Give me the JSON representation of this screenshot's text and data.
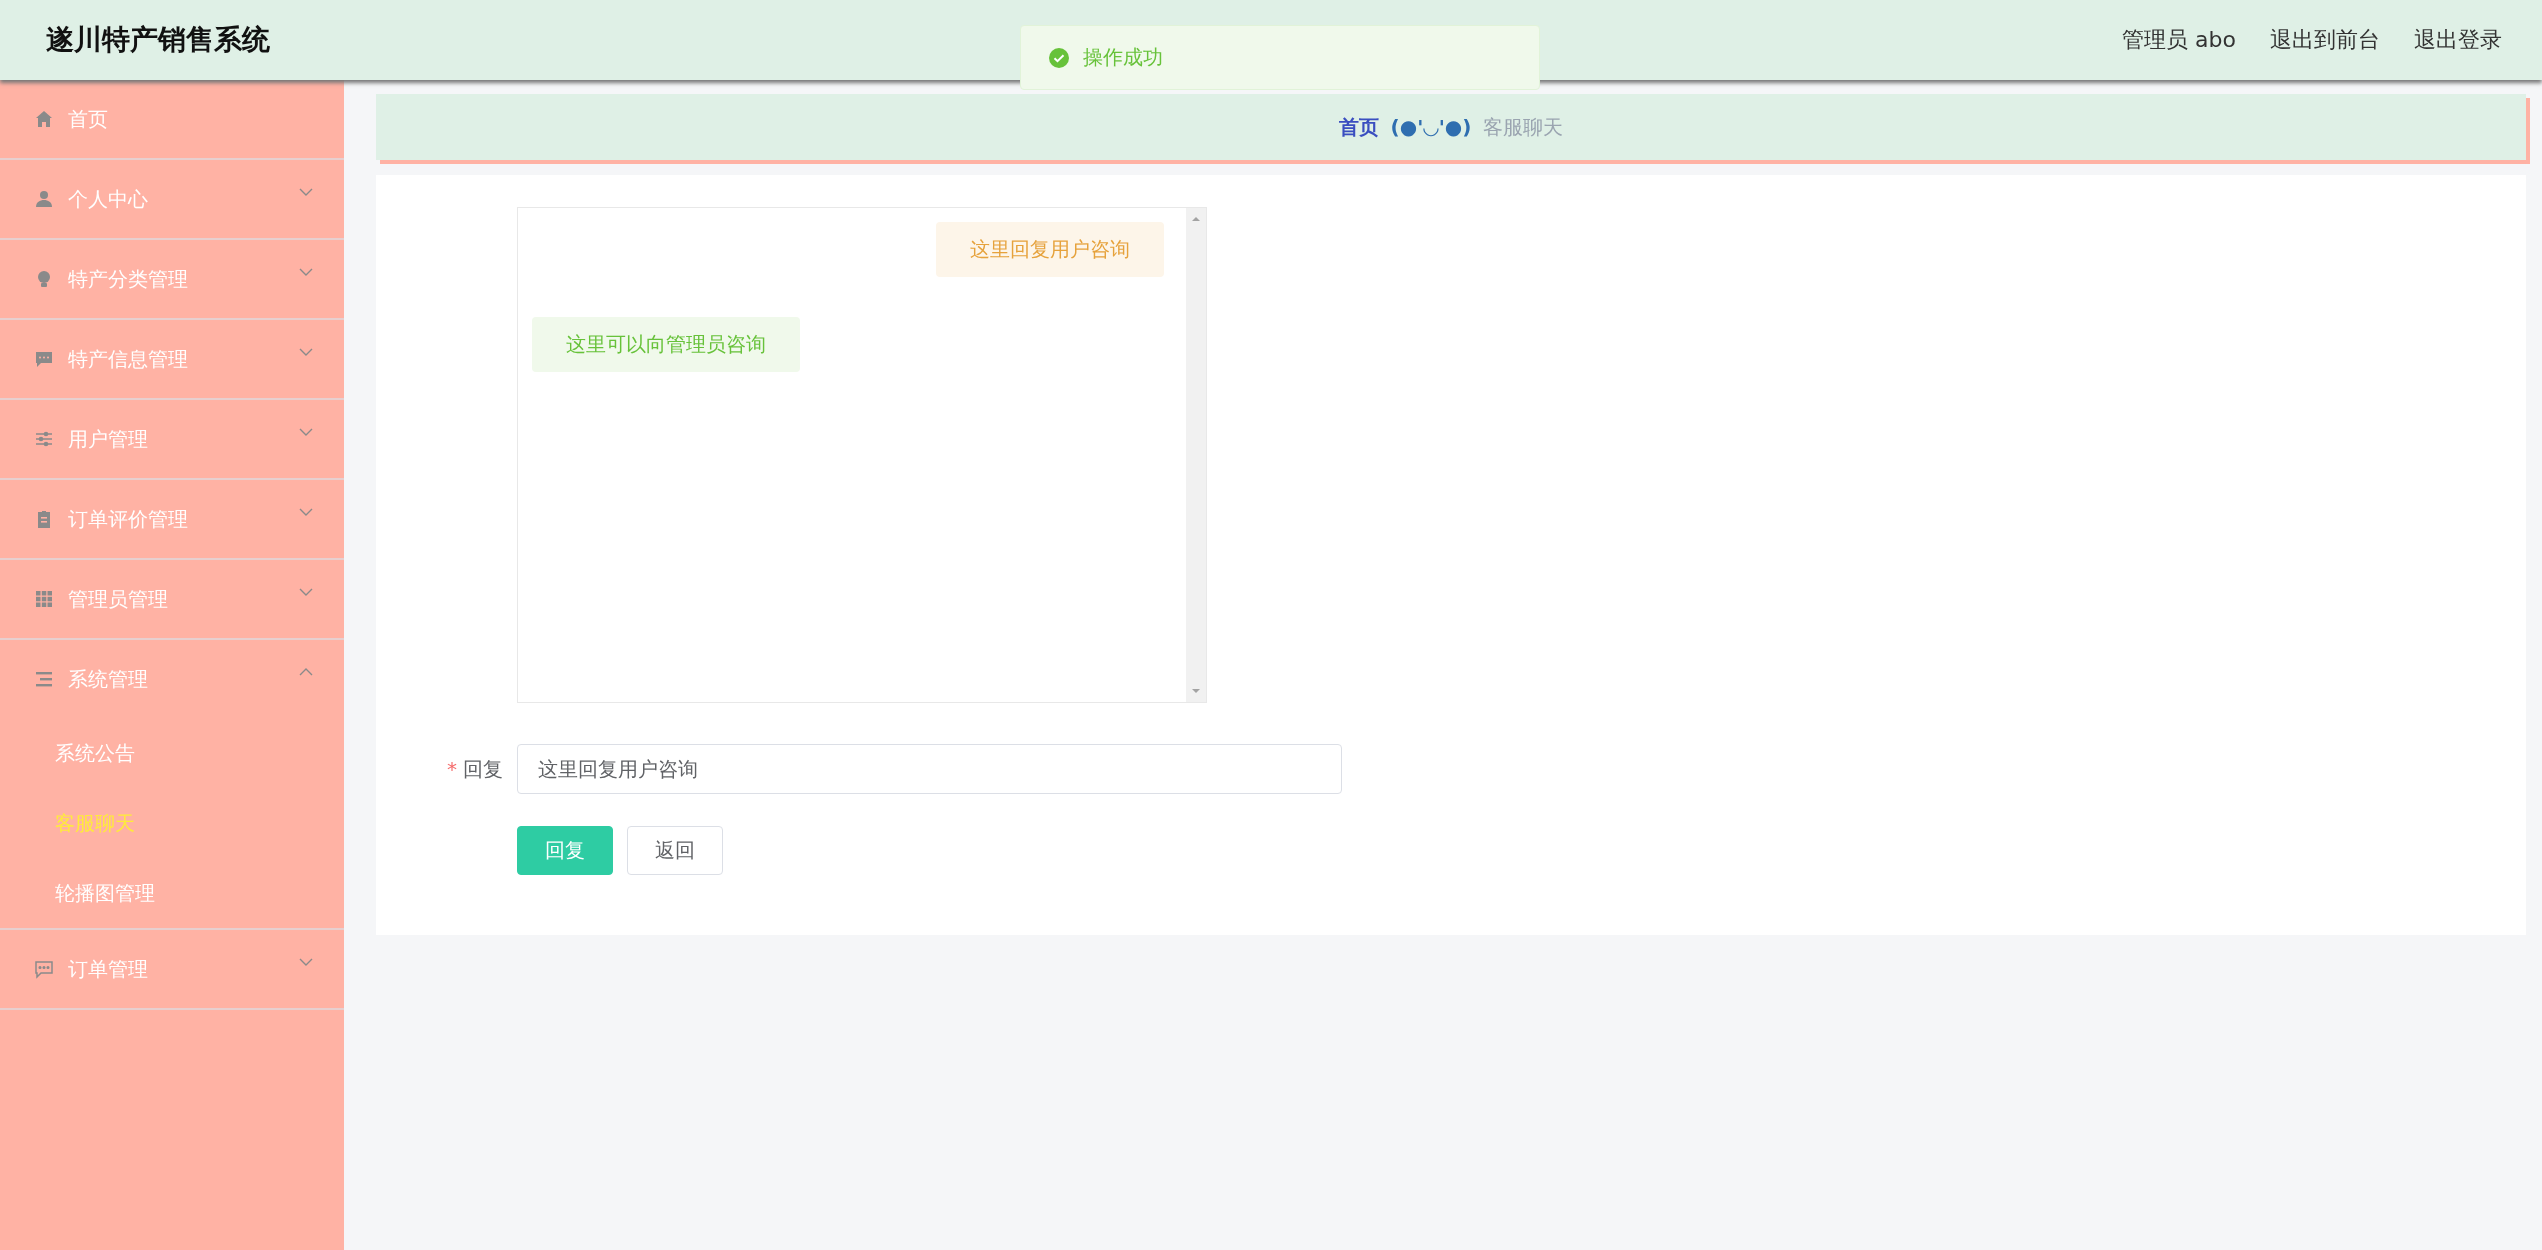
{
  "header": {
    "title": "遂川特产销售系统",
    "user": "管理员 abo",
    "links": [
      "退出到前台",
      "退出登录"
    ]
  },
  "toast": {
    "kind": "success",
    "text": "操作成功"
  },
  "sidebar": {
    "items": [
      {
        "kind": "link",
        "label": "首页"
      },
      {
        "kind": "menu",
        "label": "个人中心",
        "expanded": false
      },
      {
        "kind": "menu",
        "label": "特产分类管理",
        "expanded": false
      },
      {
        "kind": "menu",
        "label": "特产信息管理",
        "expanded": false
      },
      {
        "kind": "menu",
        "label": "用户管理",
        "expanded": false
      },
      {
        "kind": "menu",
        "label": "订单评价管理",
        "expanded": false
      },
      {
        "kind": "menu",
        "label": "管理员管理",
        "expanded": false
      },
      {
        "kind": "menu",
        "label": "系统管理",
        "expanded": true,
        "children": [
          {
            "label": "系统公告",
            "selected": false
          },
          {
            "label": "客服聊天",
            "selected": true
          },
          {
            "label": "轮播图管理",
            "selected": false
          }
        ]
      },
      {
        "kind": "menu",
        "label": "订单管理",
        "expanded": false
      }
    ]
  },
  "breadcrumb": {
    "home": "首页",
    "separator": "(●'◡'●)",
    "current": "客服聊天"
  },
  "chat": {
    "messages": [
      {
        "kind": "reply",
        "text": "这里回复用户咨询"
      },
      {
        "kind": "question",
        "text": "这里可以向管理员咨询"
      }
    ]
  },
  "form": {
    "required_mark": "*",
    "label": "回复",
    "value": "这里回复用户咨询"
  },
  "buttons": [
    {
      "kind": "primary",
      "label": "回复"
    },
    {
      "kind": "default",
      "label": "返回"
    }
  ]
}
